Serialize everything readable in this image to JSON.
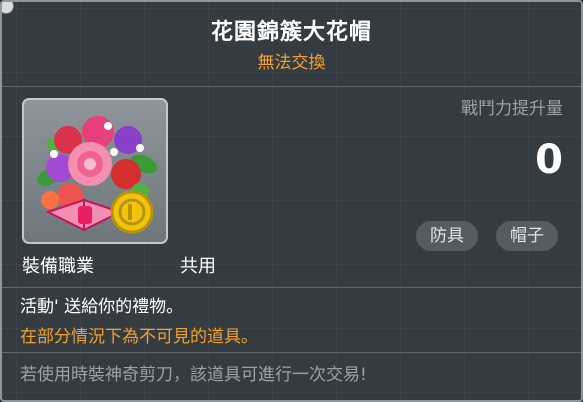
{
  "tooltip": {
    "title": "花園錦簇大花帽",
    "trade_status": "無法交換",
    "item_icon": "flower-hat-icon",
    "power": {
      "label": "戰鬥力提升量",
      "value": "0"
    },
    "tags": [
      "防具",
      "帽子"
    ],
    "job": {
      "label": "裝備職業",
      "value": "共用"
    },
    "description": [
      "活動' 送給你的禮物。",
      "在部分情況下為不可見的道具。",
      "若使用時裝神奇剪刀，該道具可進行一次交易!"
    ]
  },
  "colors": {
    "title": "#ffffff",
    "trade_status": "#f5a02c",
    "warning_text": "#f5a02c",
    "muted_text": "#9aa2a7",
    "background": "#343c42"
  }
}
